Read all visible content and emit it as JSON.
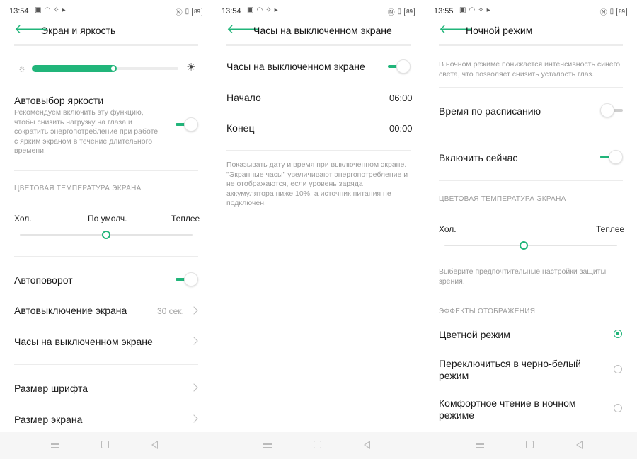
{
  "accent_color": "#21b57a",
  "status_bars": [
    {
      "time": "13:54",
      "battery": "89"
    },
    {
      "time": "13:54",
      "battery": "89"
    },
    {
      "time": "13:55",
      "battery": "89"
    }
  ],
  "screen1": {
    "title": "Экран и яркость",
    "brightness_level": 0.58,
    "auto_brightness": {
      "label": "Автовыбор яркости",
      "desc": "Рекомендуем включить эту функцию, чтобы снизить нагрузку на глаза и сократить энергопотребление при работе с ярким экраном в течение длительного времени.",
      "enabled": true
    },
    "color_temp": {
      "section": "ЦВЕТОВАЯ ТЕМПЕРАТУРА ЭКРАНА",
      "cold": "Хол.",
      "default": "По умолч.",
      "warm": "Теплее",
      "level": 0.5
    },
    "auto_rotate": {
      "label": "Автоповорот",
      "enabled": true
    },
    "screen_timeout": {
      "label": "Автовыключение экрана",
      "value": "30 сек."
    },
    "aod": {
      "label": "Часы на выключенном экране"
    },
    "font_size": {
      "label": "Размер шрифта"
    },
    "display_size": {
      "label": "Размер экрана"
    }
  },
  "screen2": {
    "title": "Часы на выключенном экране",
    "toggle_label": "Часы на выключенном экране",
    "enabled": true,
    "start": {
      "label": "Начало",
      "value": "06:00"
    },
    "end": {
      "label": "Конец",
      "value": "00:00"
    },
    "desc": "Показывать дату и время при выключенном экране. \"Экранные часы\" увеличивают энергопотребление и не отображаются, если уровень заряда аккумулятора ниже 10%, а источник питания не подключен."
  },
  "screen3": {
    "title": "Ночной режим",
    "intro": "В ночном режиме понижается интенсивность синего света, что позволяет снизить усталость глаз.",
    "schedule": {
      "label": "Время по расписанию",
      "enabled": false
    },
    "enable_now": {
      "label": "Включить сейчас",
      "enabled": true
    },
    "color_temp": {
      "section": "ЦВЕТОВАЯ ТЕМПЕРАТУРА ЭКРАНА",
      "cold": "Хол.",
      "warm": "Теплее",
      "level": 0.46
    },
    "protect_hint": "Выберите предпочтительные настройки защиты зрения.",
    "effects": {
      "section": "ЭФФЕКТЫ ОТОБРАЖЕНИЯ",
      "options": [
        {
          "label": "Цветной режим",
          "selected": true
        },
        {
          "label": "Переключиться в черно-белый режим",
          "selected": false
        },
        {
          "label": "Комфортное чтение в ночном режиме",
          "selected": false
        }
      ]
    }
  }
}
